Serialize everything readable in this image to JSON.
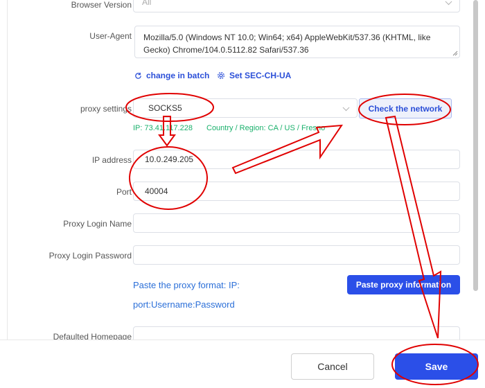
{
  "form": {
    "browser_version": {
      "label": "Browser Version",
      "value": "All"
    },
    "user_agent": {
      "label": "User-Agent",
      "value": "Mozilla/5.0 (Windows NT 10.0; Win64; x64) AppleWebKit/537.36 (KHTML, like Gecko) Chrome/104.0.5112.82 Safari/537.36"
    },
    "links": {
      "change_batch": "change in batch",
      "set_sec": "Set SEC-CH-UA"
    },
    "proxy": {
      "label": "proxy settings",
      "value": "SOCKS5",
      "check_button": "Check the network",
      "ip_info": "IP: 73.41.117.228",
      "region_info": "Country / Region: CA / US / Fresno"
    },
    "ip_address": {
      "label": "IP address",
      "value": "10.0.249.205"
    },
    "port": {
      "label": "Port",
      "value": "40004"
    },
    "login_name": {
      "label": "Proxy Login Name",
      "value": ""
    },
    "login_password": {
      "label": "Proxy Login Password",
      "value": ""
    },
    "paste_hint_line1": "Paste the proxy format: IP:",
    "paste_hint_line2": "port:Username:Password",
    "paste_button": "Paste proxy information",
    "homepage": {
      "label": "Defaulted Homepage"
    }
  },
  "footer": {
    "cancel": "Cancel",
    "save": "Save"
  },
  "colors": {
    "primary": "#2b4fe8",
    "success": "#19b06b",
    "annotation": "#e00000"
  },
  "icons": {
    "refresh": "refresh-icon",
    "gear": "gear-icon"
  }
}
